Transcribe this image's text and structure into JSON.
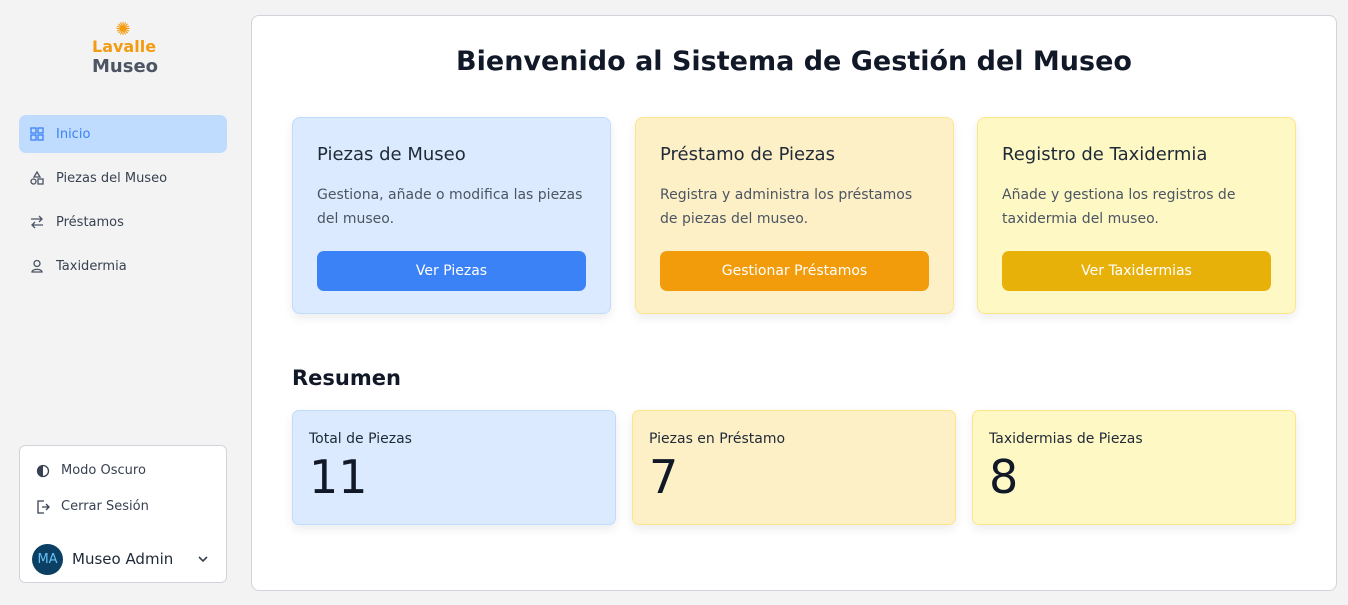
{
  "brand": {
    "line1": "Lavalle",
    "line2": "Museo",
    "icon": "sun-icon",
    "accent_color": "#f39c12"
  },
  "sidebar": {
    "items": [
      {
        "label": "Inicio",
        "icon": "grid-icon",
        "active": true
      },
      {
        "label": "Piezas del Museo",
        "icon": "shapes-icon",
        "active": false
      },
      {
        "label": "Préstamos",
        "icon": "swap-arrows-icon",
        "active": false
      },
      {
        "label": "Taxidermia",
        "icon": "person-icon",
        "active": false
      }
    ]
  },
  "user_panel": {
    "dark_mode_label": "Modo Oscuro",
    "logout_label": "Cerrar Sesión",
    "avatar_initials": "MA",
    "user_name": "Museo Admin"
  },
  "main": {
    "title": "Bienvenido al Sistema de Gestión del Museo",
    "cards": [
      {
        "title": "Piezas de Museo",
        "description": "Gestiona, añade o modifica las piezas del museo.",
        "button": "Ver Piezas",
        "button_color": "#3b82f6"
      },
      {
        "title": "Préstamo de Piezas",
        "description": "Registra y administra los préstamos de piezas del museo.",
        "button": "Gestionar Préstamos",
        "button_color": "#f39c0b"
      },
      {
        "title": "Registro de Taxidermia",
        "description": "Añade y gestiona los registros de taxidermia del museo.",
        "button": "Ver Taxidermias",
        "button_color": "#e8b10a"
      }
    ],
    "summary_title": "Resumen",
    "stats": [
      {
        "label": "Total de Piezas",
        "value": "11"
      },
      {
        "label": "Piezas en Préstamo",
        "value": "7"
      },
      {
        "label": "Taxidermias de Piezas",
        "value": "8"
      }
    ]
  }
}
